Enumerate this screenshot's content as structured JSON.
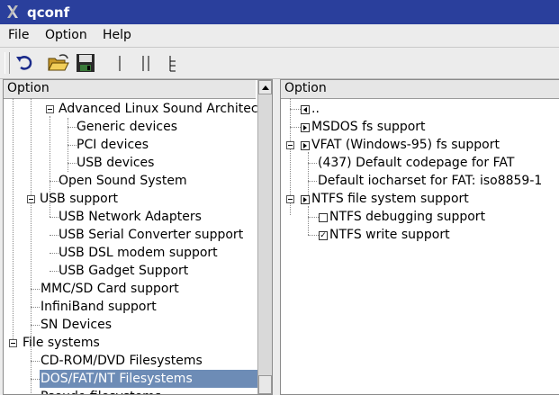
{
  "window": {
    "title": "qconf"
  },
  "menu": {
    "file": "File",
    "option": "Option",
    "help": "Help"
  },
  "toolbar": {
    "icons": [
      "undo-icon",
      "open-folder-icon",
      "save-icon",
      "single-view-icon",
      "split-view-icon",
      "full-view-icon"
    ]
  },
  "left_tree": {
    "header": "Option",
    "items": [
      "Advanced Linux Sound Architec",
      "Generic devices",
      "PCI devices",
      "USB devices",
      "Open Sound System",
      "USB support",
      "USB Network Adapters",
      "USB Serial Converter support",
      "USB DSL modem support",
      "USB Gadget Support",
      "MMC/SD Card support",
      "InfiniBand support",
      "SN Devices",
      "File systems",
      "CD-ROM/DVD Filesystems",
      "DOS/FAT/NT Filesystems",
      "Pseudo filesystems"
    ],
    "selected": "DOS/FAT/NT Filesystems"
  },
  "right_list": {
    "header": "Option",
    "items": [
      "..",
      "MSDOS fs support",
      "VFAT (Windows-95) fs support",
      "(437) Default codepage for FAT",
      "Default iocharset for FAT: iso8859-1",
      "NTFS file system support",
      "NTFS debugging support",
      "NTFS write support"
    ],
    "checkbox_marks": {
      "ntfs_debugging": "",
      "ntfs_write": "✓"
    }
  }
}
